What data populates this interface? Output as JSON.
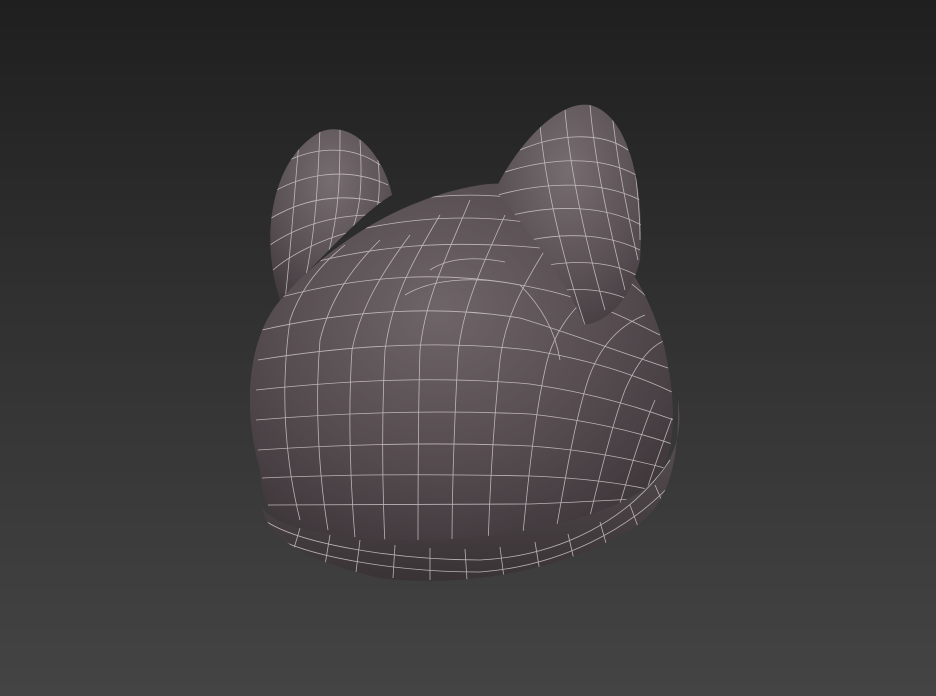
{
  "viewport": {
    "background_top": "#1f1f1f",
    "background_bottom": "#444444",
    "model": {
      "name": "helmet-with-ears",
      "shading_color": "#5a5154",
      "wire_color": "#d9d2d4",
      "display_mode": "smooth-shaded-with-edged-faces"
    }
  }
}
